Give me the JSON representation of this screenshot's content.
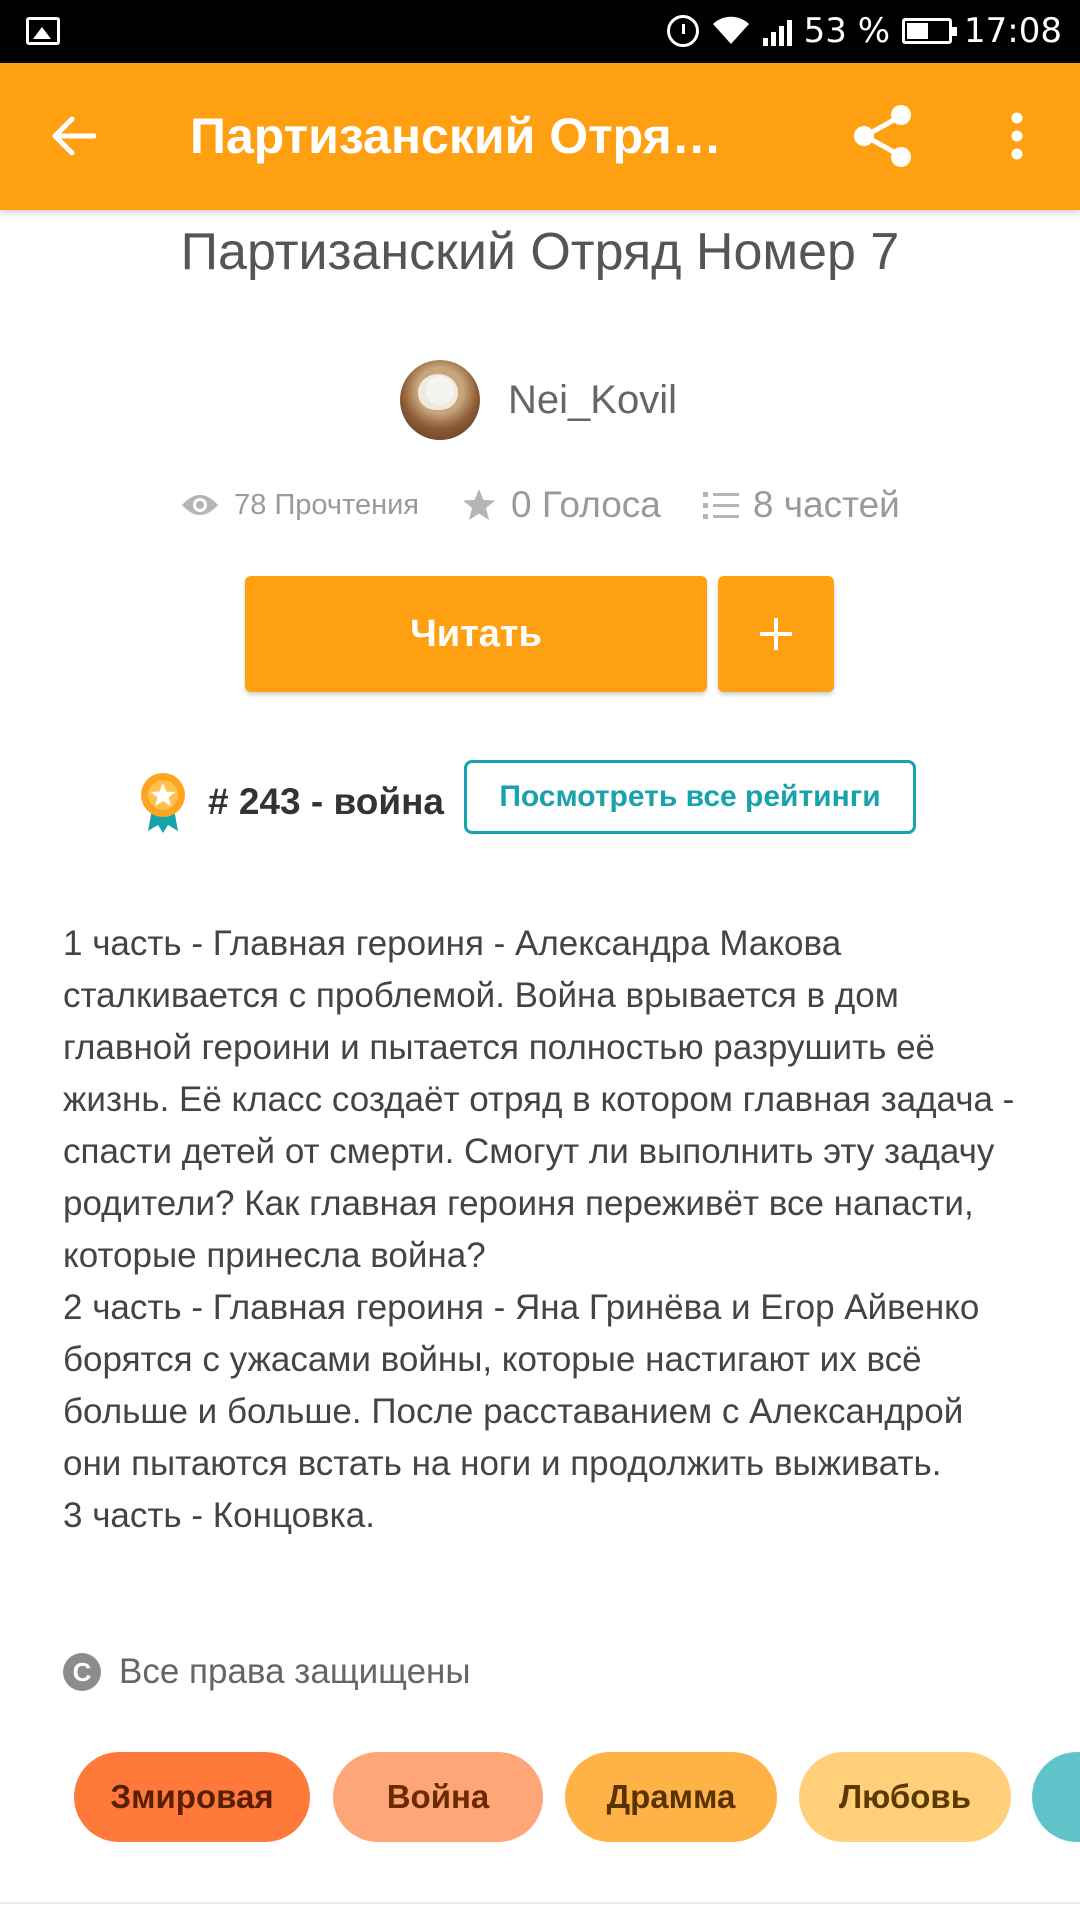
{
  "status_bar": {
    "battery_percent": "53 %",
    "battery_level": 0.53,
    "time": "17:08",
    "icons": [
      "image-notification-icon",
      "alarm-icon",
      "wifi-icon",
      "signal-icon",
      "battery-icon"
    ]
  },
  "app_bar": {
    "title": "Партизанский Отряд Номер 7",
    "color": "#ff9f12",
    "back_icon": "arrow-back-icon",
    "share_icon": "share-icon",
    "more_icon": "more-vert-icon"
  },
  "story": {
    "title": "Партизанский Отряд Номер 7",
    "author": "Nei_Kovil",
    "stats": {
      "reads": "78 Прочтения",
      "votes": "0 Голоса",
      "parts": "8 частей"
    },
    "read_button": "Читать",
    "add_button": "+",
    "ranking": {
      "text": "# 243 - война",
      "all_rankings_button": "Посмотреть все рейтинги"
    },
    "description": [
      "1 часть - Главная героиня - Александра Макова сталкивается с проблемой. Война врывается в дом главной героини и пытается полностью разрушить её жизнь. Её класс создаёт отряд в котором главная задача - спасти детей от смерти. Смогут ли выполнить эту задачу родители? Как главная героиня переживёт все напасти, которые принесла война?",
      "2 часть - Главная героиня - Яна Гринёва и Егор Айвенко борятся с ужасами войны, которые настигают их всё больше и больше. После расставанием с Александрой они пытаются встать на ноги и продолжить выживать.",
      "3 часть - Концовка."
    ],
    "copyright": "Все права защищены",
    "tags": [
      {
        "label": "Змировая",
        "bg": "#ff7a3a",
        "fg": "#5a1e00"
      },
      {
        "label": "Война",
        "bg": "#ffa679",
        "fg": "#6b2a00"
      },
      {
        "label": "Драмма",
        "bg": "#ffb347",
        "fg": "#5a3200"
      },
      {
        "label": "Любовь",
        "bg": "#ffcf7a",
        "fg": "#5a3a00"
      }
    ]
  },
  "colors": {
    "accent": "#ff9f12",
    "teal": "#17a3ad"
  }
}
